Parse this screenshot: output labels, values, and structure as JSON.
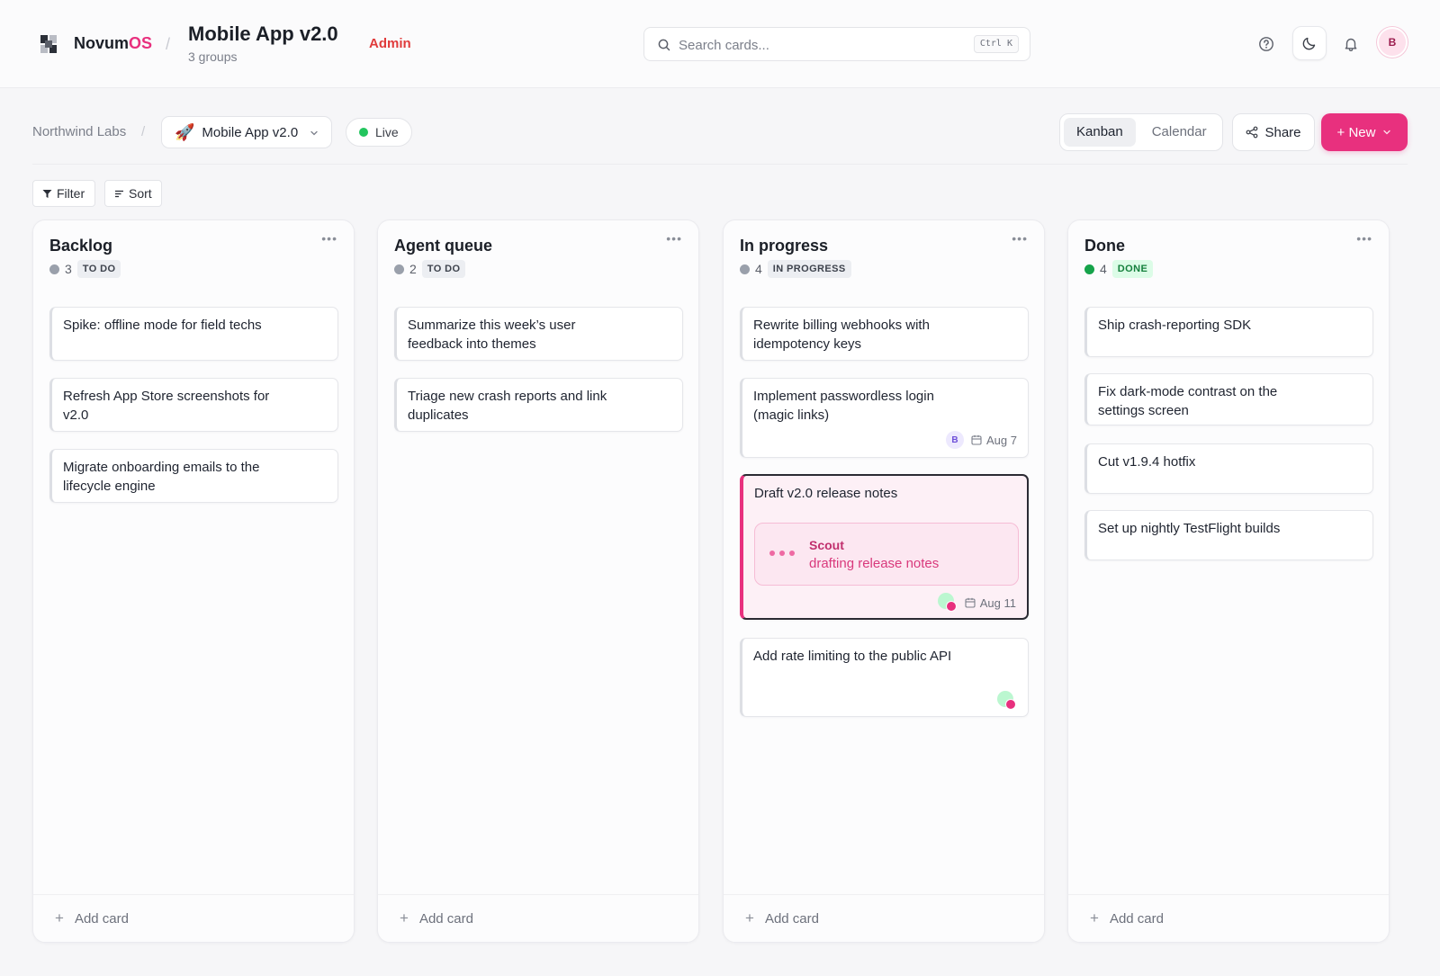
{
  "app": {
    "brand_main": "Novum",
    "brand_accent": "OS",
    "accent_color": "#e8307e"
  },
  "header": {
    "title": "Mobile App v2.0",
    "subtitle": "3 groups",
    "role": "Admin",
    "search": {
      "placeholder": "Search cards...",
      "shortcut": "Ctrl K"
    },
    "avatar_initial": "B",
    "icons": [
      "help-icon",
      "moon-icon",
      "bell-icon"
    ]
  },
  "toolbar": {
    "breadcrumb": "Northwind Labs",
    "project": "Mobile App v2.0",
    "project_emoji": "🚀",
    "status": "Live",
    "views": [
      "Kanban",
      "Calendar"
    ],
    "active_view": "Kanban",
    "share": "Share",
    "new": "+ New",
    "filter": "Filter",
    "sort": "Sort"
  },
  "columns": [
    {
      "title": "Backlog",
      "count": "3",
      "tag": "TO DO",
      "cards": [
        {
          "title": "Spike: offline mode for field techs"
        },
        {
          "title": "Refresh App Store screenshots for v2.0"
        },
        {
          "title": "Migrate onboarding emails to the lifecycle engine"
        }
      ],
      "add": "Add card"
    },
    {
      "title": "Agent queue",
      "count": "2",
      "tag": "TO DO",
      "cards": [
        {
          "title": "Summarize this week’s user feedback into themes"
        },
        {
          "title": "Triage new crash reports and link duplicates"
        }
      ],
      "add": "Add card"
    },
    {
      "title": "In progress",
      "count": "4",
      "tag": "IN PROGRESS",
      "cards": [
        {
          "title": "Rewrite billing webhooks with idempotency keys"
        },
        {
          "title": "Implement passwordless login (magic links)",
          "assignee": "B",
          "due": "Aug 7"
        },
        {
          "title": "Draft v2.0 release notes",
          "agent": "Scout",
          "agent_status": "drafting release notes",
          "due": "Aug 11"
        },
        {
          "title": "Add rate limiting to the public API"
        }
      ],
      "add": "Add card"
    },
    {
      "title": "Done",
      "count": "4",
      "tag": "DONE",
      "cards": [
        {
          "title": "Ship crash-reporting SDK"
        },
        {
          "title": "Fix dark-mode contrast on the settings screen"
        },
        {
          "title": "Cut v1.9.4 hotfix"
        },
        {
          "title": "Set up nightly TestFlight builds"
        }
      ],
      "add": "Add card"
    }
  ]
}
